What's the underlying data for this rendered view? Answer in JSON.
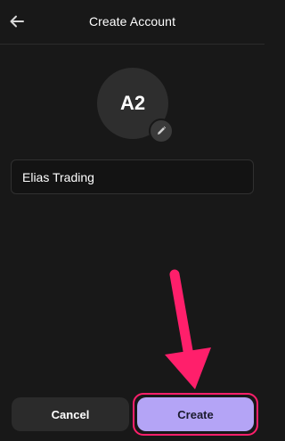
{
  "header": {
    "title": "Create Account",
    "back_icon": "arrow-left-icon"
  },
  "avatar": {
    "initials": "A2",
    "edit_icon": "pencil-icon"
  },
  "form": {
    "account_name_value": "Elias Trading"
  },
  "actions": {
    "cancel_label": "Cancel",
    "create_label": "Create"
  },
  "colors": {
    "background": "#181818",
    "accent": "#b4a4f6",
    "annotation": "#ff1f6b"
  }
}
